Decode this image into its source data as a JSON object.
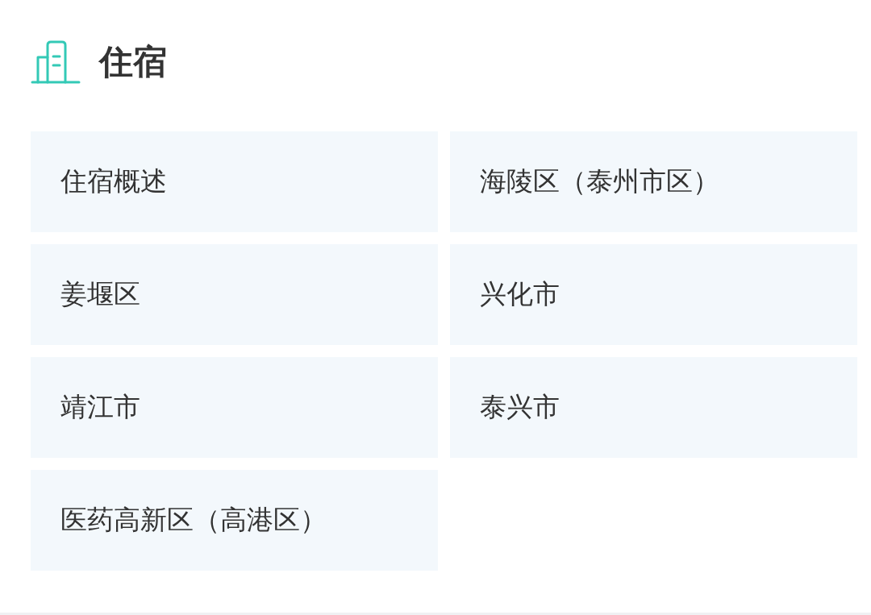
{
  "section": {
    "title": "住宿"
  },
  "items": [
    {
      "label": "住宿概述"
    },
    {
      "label": "海陵区（泰州市区）"
    },
    {
      "label": "姜堰区"
    },
    {
      "label": "兴化市"
    },
    {
      "label": "靖江市"
    },
    {
      "label": "泰兴市"
    },
    {
      "label": "医药高新区（高港区）"
    }
  ]
}
